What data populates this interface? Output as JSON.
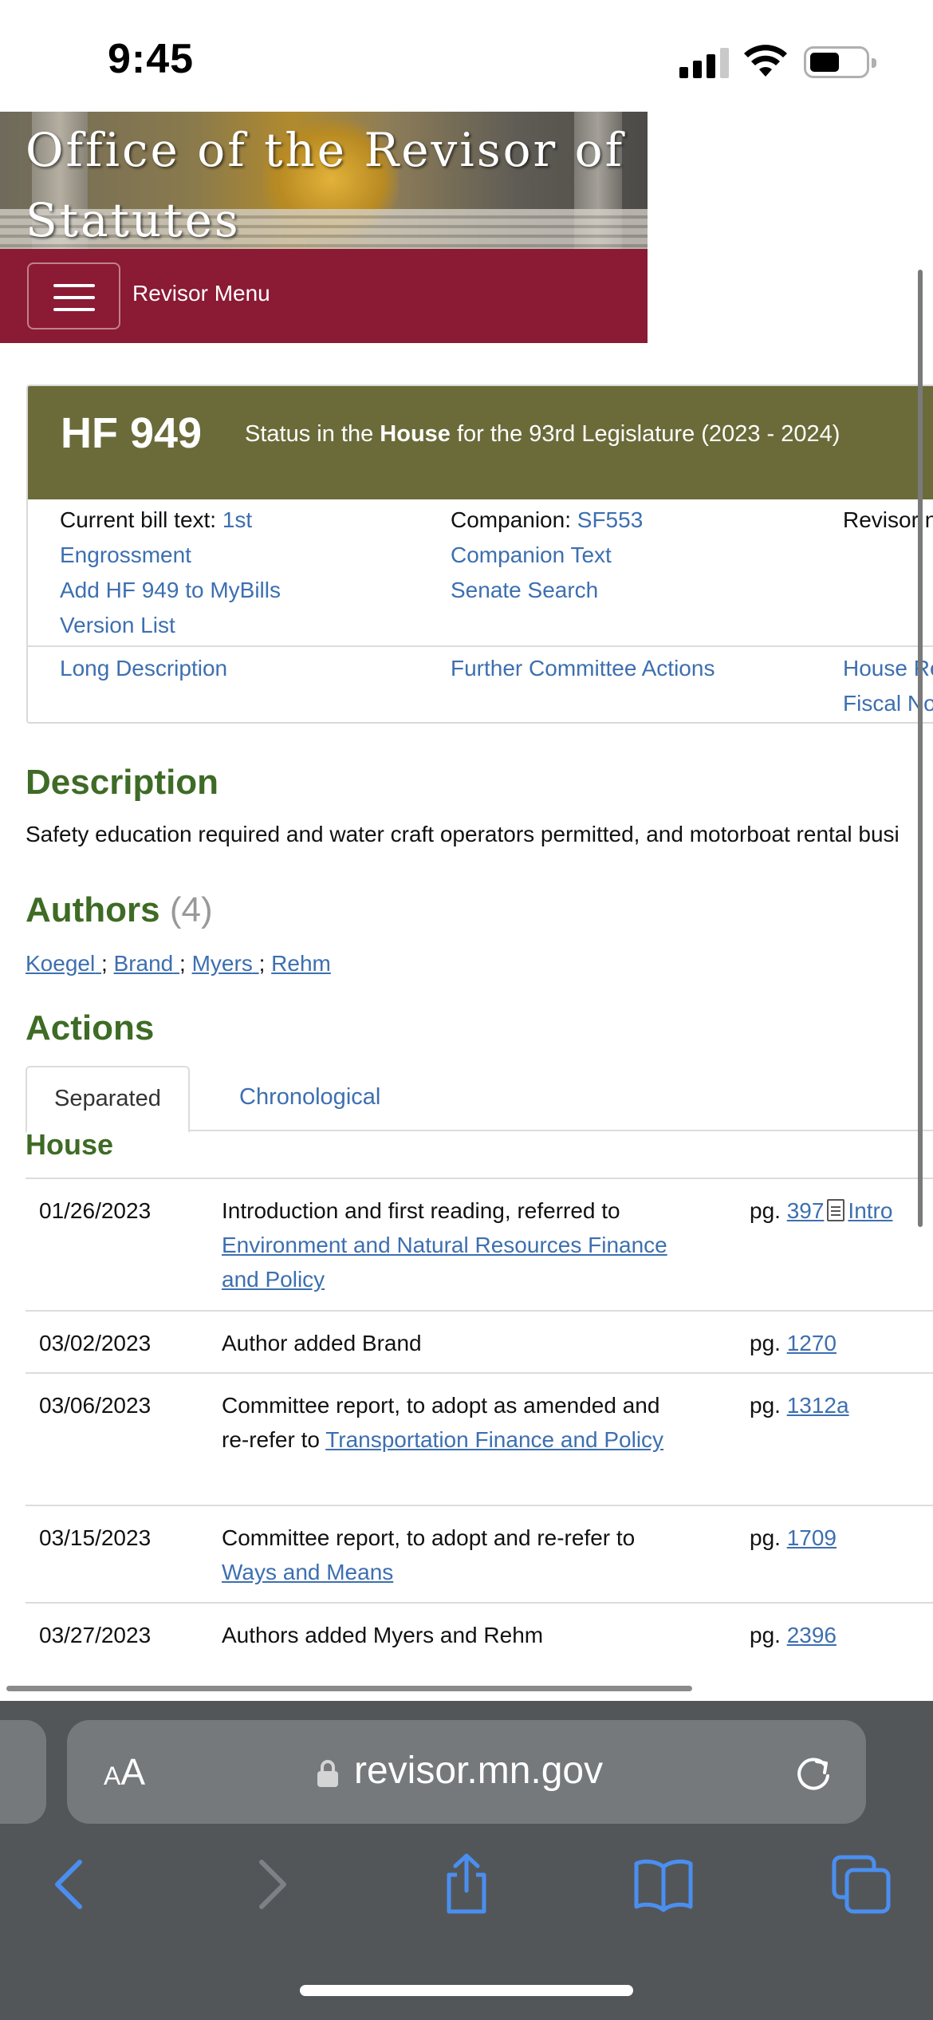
{
  "status_bar": {
    "time": "9:45"
  },
  "site": {
    "banner_title_line1": "Office of the Revisor of",
    "banner_title_line2": "Statutes",
    "menu_label": "Revisor Menu"
  },
  "bill": {
    "number": "HF 949",
    "status_prefix": "Status in the ",
    "status_chamber": "House",
    "status_suffix": " for the 93rd Legislature (2023 - 2024)",
    "current_text_label": "Current bill text: ",
    "current_text_link_1": "1st",
    "current_text_link_2": "Engrossment",
    "add_mybills": "Add HF 949 to MyBills",
    "version_list": "Version List",
    "companion_label": "Companion: ",
    "companion_link": "SF553",
    "companion_text": "Companion Text",
    "senate_search": "Senate Search",
    "revisor_partial": "Revisor n",
    "long_description": "Long Description",
    "further_actions": "Further Committee Actions",
    "house_partial": "House Re",
    "fiscal_partial": "Fiscal No"
  },
  "description": {
    "heading": "Description",
    "text": "Safety education required and water craft operators permitted, and motorboat rental busi"
  },
  "authors": {
    "heading": "Authors",
    "count": "(4)",
    "list": [
      "Koegel",
      "Brand",
      "Myers",
      "Rehm"
    ]
  },
  "actions": {
    "heading": "Actions",
    "tabs": [
      "Separated",
      "Chronological"
    ],
    "chamber": "House",
    "rows": [
      {
        "date": "01/26/2023",
        "text": "Introduction and first reading, referred to ",
        "link": "Environment and Natural Resources Finance and Policy",
        "pg_label": "pg. ",
        "pg": "397",
        "extra": "Intro"
      },
      {
        "date": "03/02/2023",
        "text": "Author added Brand",
        "link": "",
        "pg_label": "pg. ",
        "pg": "1270"
      },
      {
        "date": "03/06/2023",
        "text": "Committee report, to adopt as amended and re-refer to ",
        "link": "Transportation Finance and Policy",
        "pg_label": "pg. ",
        "pg": "1312a"
      },
      {
        "date": "03/15/2023",
        "text": "Committee report, to adopt and re-refer to ",
        "link": "Ways and Means",
        "pg_label": "pg. ",
        "pg": "1709"
      },
      {
        "date": "03/27/2023",
        "text": "Authors added Myers and Rehm",
        "link": "",
        "pg_label": "pg. ",
        "pg": "2396"
      }
    ]
  },
  "browser": {
    "text_size_label_small": "A",
    "text_size_label_large": "A",
    "url": "revisor.mn.gov"
  },
  "colors": {
    "menu_bar": "#8b1a34",
    "bill_header": "#6b6b3a",
    "section_heading": "#3e6b25",
    "link": "#3d6fb0",
    "safari_toolbar": "#535659",
    "safari_icon": "#4a8ff0"
  },
  "icons": {
    "menu": "hamburger-icon",
    "lock": "lock-icon",
    "reload": "reload-icon",
    "back": "chevron-left-icon",
    "forward": "chevron-right-icon",
    "share": "share-icon",
    "bookmarks": "book-icon",
    "tabs": "tabs-icon",
    "document": "document-icon"
  }
}
